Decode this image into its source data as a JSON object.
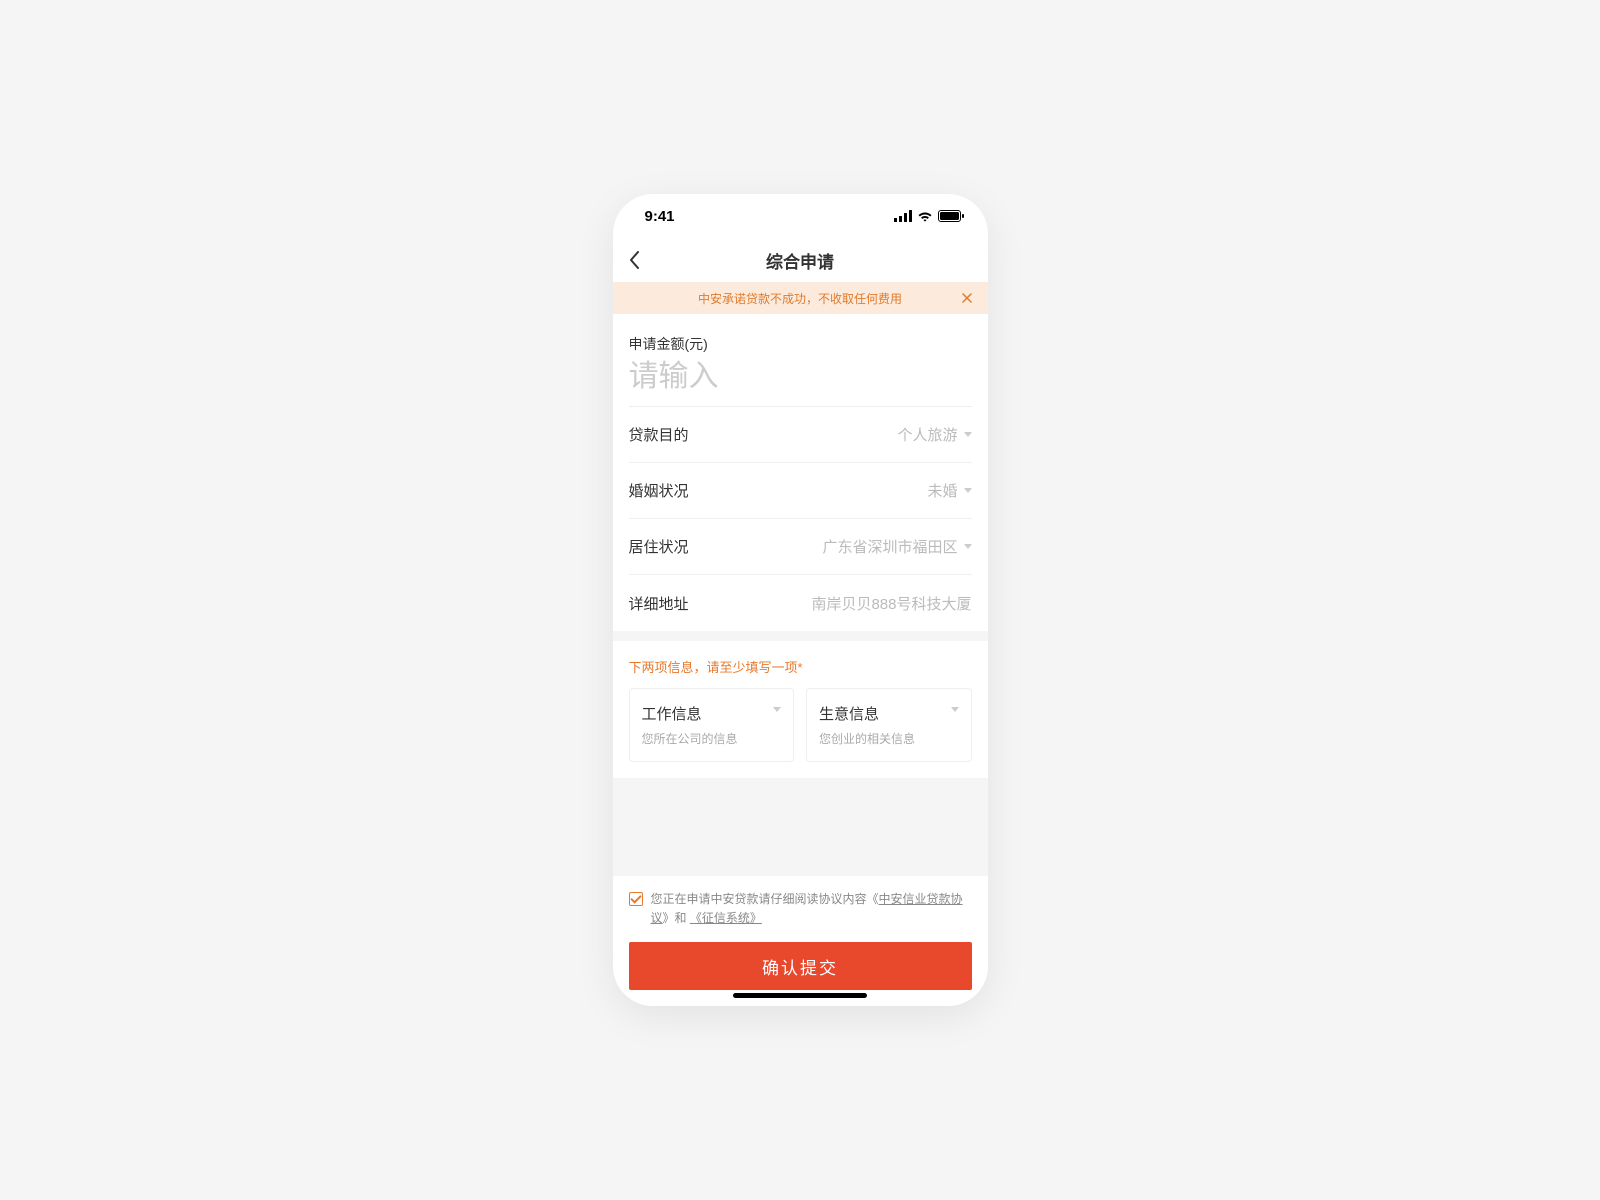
{
  "status": {
    "time": "9:41"
  },
  "nav": {
    "title": "综合申请"
  },
  "banner": {
    "text": "中安承诺贷款不成功，不收取任何费用"
  },
  "form": {
    "amount_label": "申请金额(元)",
    "amount_placeholder": "请输入",
    "rows": {
      "purpose": {
        "label": "贷款目的",
        "value": "个人旅游"
      },
      "marital": {
        "label": "婚姻状况",
        "value": "未婚"
      },
      "residence": {
        "label": "居住状况",
        "value": "广东省深圳市福田区"
      },
      "address": {
        "label": "详细地址",
        "value": "南岸贝贝888号科技大厦"
      }
    }
  },
  "section2": {
    "title": "下两项信息，请至少填写一项",
    "cards": {
      "work": {
        "title": "工作信息",
        "sub": "您所在公司的信息"
      },
      "business": {
        "title": "生意信息",
        "sub": "您创业的相关信息"
      }
    }
  },
  "agree": {
    "prefix": "您正在申请中安贷款请仔细阅读协议内容",
    "link1_open": "《",
    "link1": "中安信业贷款协议",
    "link1_close": "》",
    "and": "和",
    "link2_open": "《",
    "link2": "征信系统",
    "link2_close": "》"
  },
  "submit": {
    "label": "确认提交"
  }
}
